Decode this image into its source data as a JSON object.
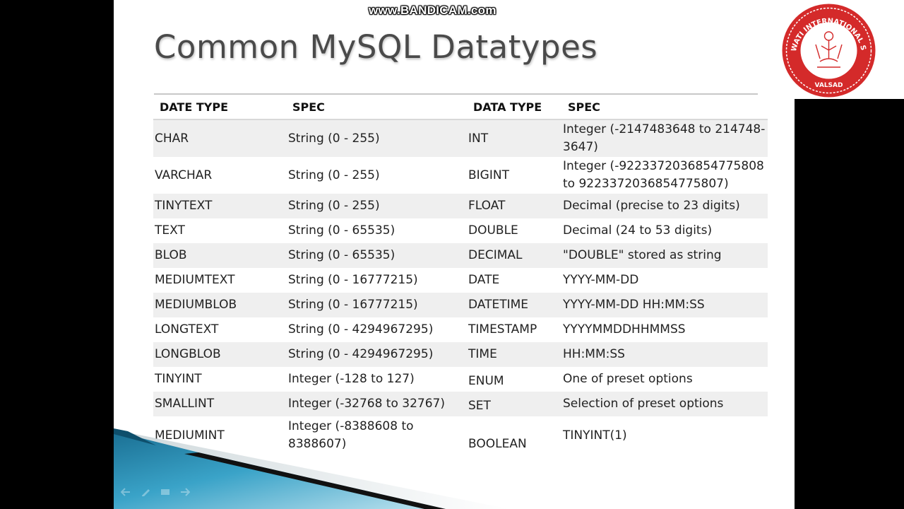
{
  "watermark": "www.BANDICAM.com",
  "slide": {
    "title": "Common MySQL Datatypes"
  },
  "logo": {
    "text_top": "SARASWATI INTERNATIONAL SCHOOL",
    "text_bottom": "VALSAD",
    "color": "#d42a2a"
  },
  "table": {
    "headers": [
      "DATE TYPE",
      "SPEC",
      "DATA TYPE",
      "SPEC"
    ],
    "rows": [
      [
        "CHAR",
        "String (0 - 255)",
        "INT",
        "Integer (-2147483648 to 214748-3647)"
      ],
      [
        "VARCHAR",
        "String (0 - 255)",
        "BIGINT",
        "Integer (-9223372036854775808 to 9223372036854775807)"
      ],
      [
        "TINYTEXT",
        "String (0 - 255)",
        "FLOAT",
        "Decimal (precise to 23 digits)"
      ],
      [
        "TEXT",
        "String (0 - 65535)",
        "DOUBLE",
        "Decimal (24 to 53 digits)"
      ],
      [
        "BLOB",
        "String (0 - 65535)",
        "DECIMAL",
        "\"DOUBLE\" stored as string"
      ],
      [
        "MEDIUMTEXT",
        "String (0 - 16777215)",
        "DATE",
        "YYYY-MM-DD"
      ],
      [
        "MEDIUMBLOB",
        "String (0 - 16777215)",
        "DATETIME",
        "YYYY-MM-DD HH:MM:SS"
      ],
      [
        "LONGTEXT",
        "String (0 - 4294967295)",
        "TIMESTAMP",
        "YYYYMMDDHHMMSS"
      ],
      [
        "LONGBLOB",
        "String (0 - 4294967295)",
        "TIME",
        "HH:MM:SS"
      ],
      [
        "TINYINT",
        "Integer (-128 to 127)",
        "ENUM",
        "One of preset options"
      ],
      [
        "SMALLINT",
        "Integer (-32768 to 32767)",
        "SET",
        "Selection of preset options"
      ],
      [
        "MEDIUMINT",
        "Integer (-8388608 to 8388607)",
        "BOOLEAN",
        "TINYINT(1)"
      ]
    ]
  },
  "colors": {
    "row_shade": "#efefef",
    "accent_blue": "#1f8fb0"
  }
}
